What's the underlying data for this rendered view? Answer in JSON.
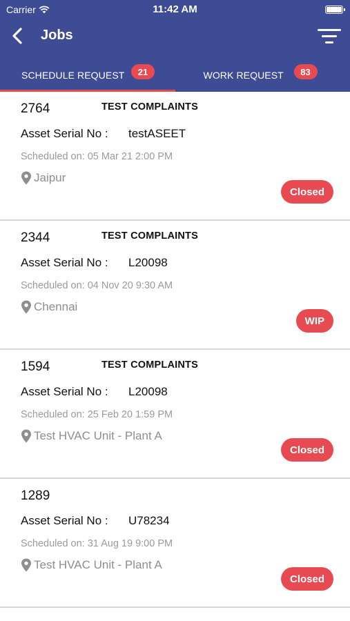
{
  "status_bar": {
    "carrier": "Carrier",
    "time": "11:42 AM"
  },
  "header": {
    "title": "Jobs",
    "back_icon": "chevron-left-icon",
    "filter_icon": "filter-icon"
  },
  "tabs": [
    {
      "label": "SCHEDULE REQUEST",
      "count": "21",
      "active": true
    },
    {
      "label": "WORK REQUEST",
      "count": "83",
      "active": false
    }
  ],
  "colors": {
    "header": "#3d4c95",
    "accent": "#e84a52",
    "muted": "#9a9a9a"
  },
  "asset_label": "Asset Serial No :",
  "jobs": [
    {
      "id": "2764",
      "type": "TEST COMPLAINTS",
      "serial": "testASEET",
      "scheduled": "Scheduled on: 05 Mar 21 2:00 PM",
      "location": "Jaipur",
      "status": "Closed"
    },
    {
      "id": "2344",
      "type": "TEST COMPLAINTS",
      "serial": "L20098",
      "scheduled": "Scheduled on: 04 Nov 20 9:30 AM",
      "location": "Chennai",
      "status": "WIP"
    },
    {
      "id": "1594",
      "type": "TEST COMPLAINTS",
      "serial": "L20098",
      "scheduled": "Scheduled on: 25 Feb 20 1:59 PM",
      "location": "Test HVAC Unit - Plant A",
      "status": "Closed"
    },
    {
      "id": "1289",
      "type": "",
      "serial": "U78234",
      "scheduled": "Scheduled on: 31 Aug 19 9:00 PM",
      "location": "Test HVAC Unit - Plant A",
      "status": "Closed"
    }
  ]
}
